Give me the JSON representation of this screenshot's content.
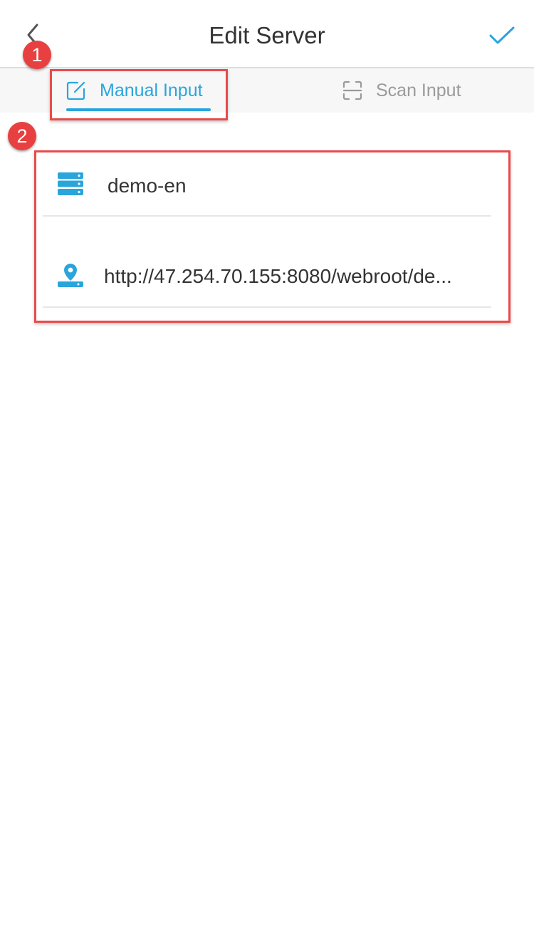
{
  "header": {
    "title": "Edit Server",
    "back_icon": "chevron-left-icon",
    "confirm_icon": "checkmark-icon"
  },
  "tabs": [
    {
      "label": "Manual Input",
      "icon": "edit-icon",
      "active": true
    },
    {
      "label": "Scan Input",
      "icon": "scan-icon",
      "active": false
    }
  ],
  "annotations": {
    "badge_1": "1",
    "badge_2": "2"
  },
  "form": {
    "server_name": {
      "value": "demo-en",
      "icon": "server-icon"
    },
    "server_url": {
      "value": "http://47.254.70.155:8080/webroot/de...",
      "icon": "location-pin-icon"
    }
  },
  "colors": {
    "accent": "#2aa5dc",
    "annotation_red": "#e84a4a",
    "tab_background": "#f7f7f7",
    "inactive_text": "#9a9a9a"
  }
}
